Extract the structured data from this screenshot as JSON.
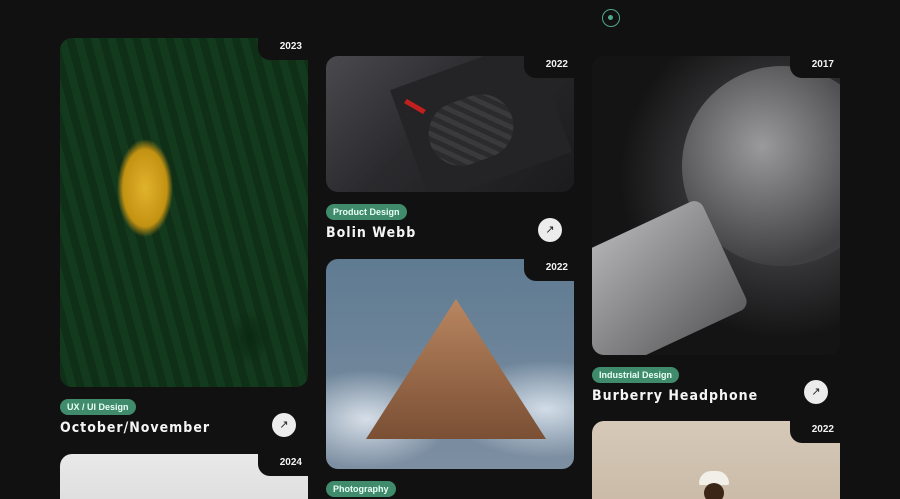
{
  "header": {
    "indicator_icon": "target-dot-icon"
  },
  "colors": {
    "background": "#111111",
    "accent": "#3f8b6c",
    "arrow_button": "#ececec"
  },
  "projects": [
    {
      "year": "2023",
      "category": "UX / UI Design",
      "title": "October/November",
      "image": "forest-larch-photo"
    },
    {
      "year": "2022",
      "category": "Product Design",
      "title": "Bolin Webb",
      "image": "razor-case-photo"
    },
    {
      "year": "2017",
      "category": "Industrial Design",
      "title": "Burberry Headphone",
      "image": "headphone-closeup-photo"
    },
    {
      "year": "2022",
      "category": "Photography",
      "title": "",
      "image": "foggy-hill-photo"
    },
    {
      "year": "2024",
      "category": "",
      "title": "",
      "image": "white-product-photo"
    },
    {
      "year": "2022",
      "category": "",
      "title": "",
      "image": "portrait-hat-photo"
    }
  ],
  "icons": {
    "arrow": "↗"
  }
}
